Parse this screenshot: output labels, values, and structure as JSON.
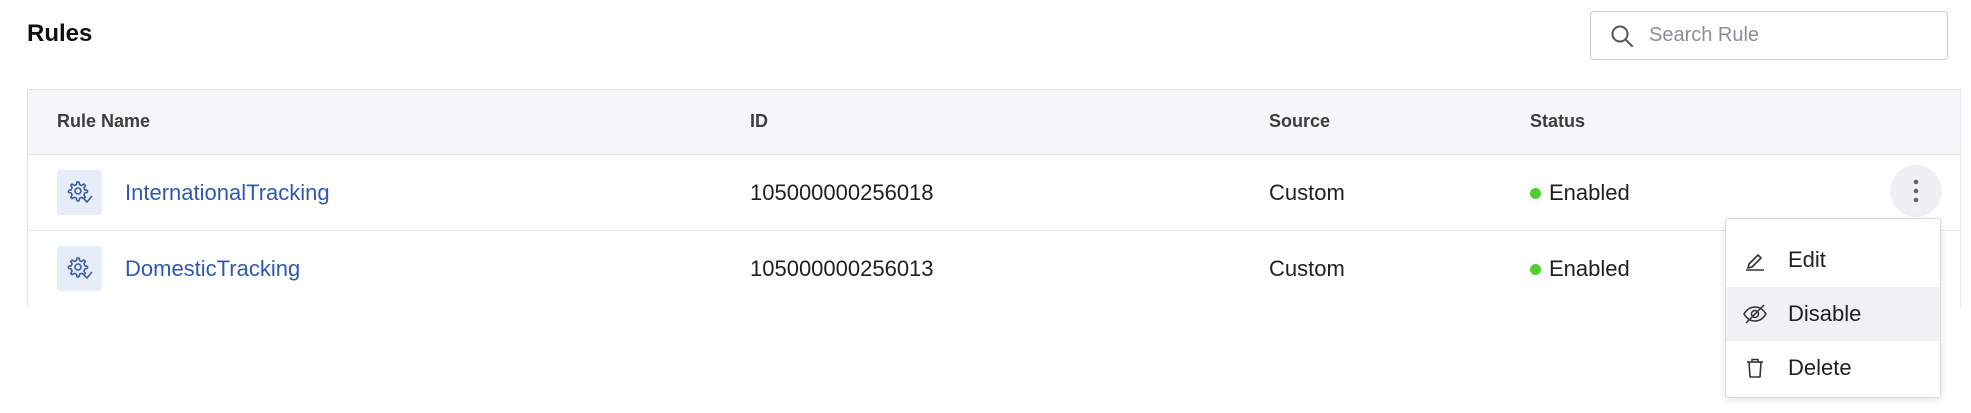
{
  "page": {
    "title": "Rules"
  },
  "search": {
    "placeholder": "Search Rule",
    "value": ""
  },
  "table": {
    "columns": [
      "Rule Name",
      "ID",
      "Source",
      "Status"
    ],
    "rows": [
      {
        "name": "InternationalTracking",
        "id": "105000000256018",
        "source": "Custom",
        "status": "Enabled"
      },
      {
        "name": "DomesticTracking",
        "id": "105000000256013",
        "source": "Custom",
        "status": "Enabled"
      }
    ]
  },
  "menu": {
    "items": [
      {
        "label": "Edit",
        "icon": "edit-icon"
      },
      {
        "label": "Disable",
        "icon": "eye-off-icon"
      },
      {
        "label": "Delete",
        "icon": "trash-icon"
      }
    ]
  },
  "colors": {
    "link": "#2f58b5",
    "status_enabled": "#4ccf2f",
    "header_bg": "#f6f7f8",
    "icon_bg": "#e6edf9"
  }
}
